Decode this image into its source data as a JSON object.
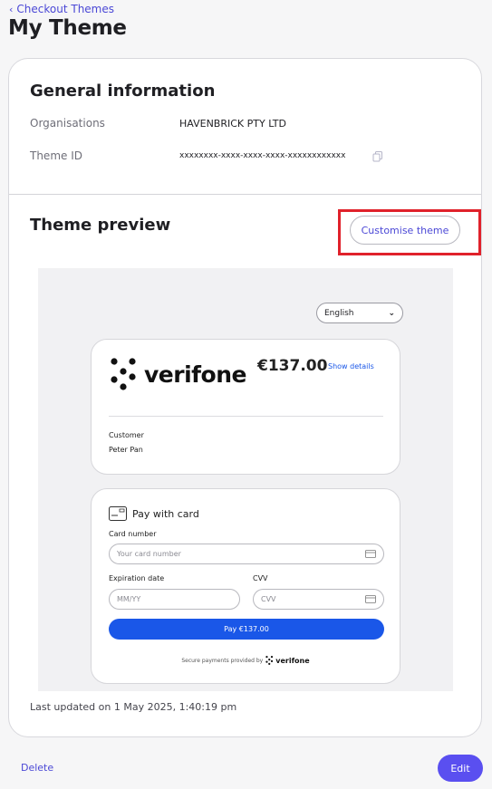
{
  "breadcrumb": {
    "back_label": "Checkout Themes"
  },
  "page": {
    "title": "My Theme"
  },
  "general_info": {
    "title": "General information",
    "organisations_label": "Organisations",
    "organisations_value": "HAVENBRICK PTY LTD",
    "theme_id_label": "Theme ID",
    "theme_id_value": "xxxxxxxx-xxxx-xxxx-xxxx-xxxxxxxxxxxx"
  },
  "theme_preview": {
    "title": "Theme preview",
    "customise_label": "Customise theme",
    "preview": {
      "language": "English",
      "brand": "verifone",
      "amount": "€137.00",
      "show_details": "Show details",
      "customer_label": "Customer",
      "customer_name": "Peter Pan",
      "pay_with_card": "Pay with card",
      "card_number_label": "Card number",
      "card_number_placeholder": "Your card number",
      "expiration_label": "Expiration date",
      "expiration_placeholder": "MM/YY",
      "cvv_label": "CVV",
      "cvv_placeholder": "CVV",
      "pay_button": "Pay €137.00",
      "secure_text": "Secure payments provided by",
      "footer_brand": "verifone"
    }
  },
  "footer": {
    "last_updated": "Last updated on 1 May 2025, 1:40:19 pm",
    "delete_label": "Delete",
    "edit_label": "Edit"
  },
  "colors": {
    "accent": "#4b48d6",
    "edit_button": "#5a4ff0",
    "highlight": "#e0212b",
    "pay_button": "#1a57e8"
  }
}
